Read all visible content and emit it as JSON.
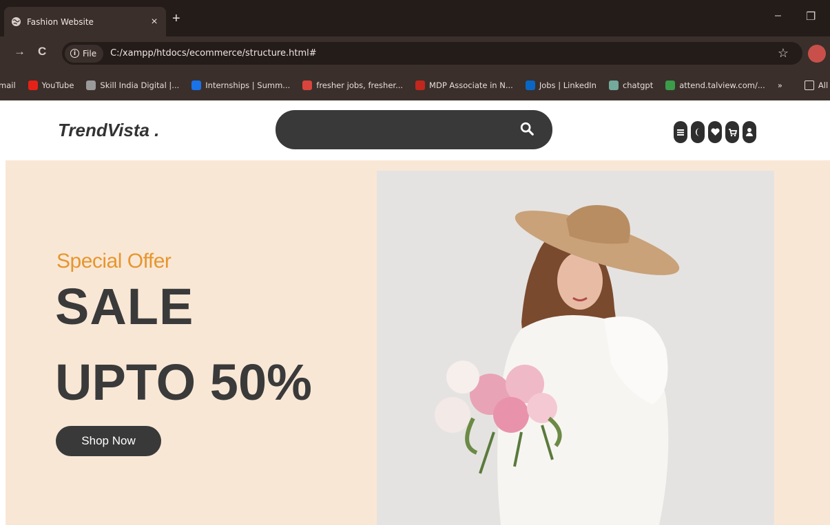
{
  "browser": {
    "tab_title": "Fashion Website",
    "tab_close": "×",
    "new_tab": "+",
    "minimize": "–",
    "restore": "❐",
    "nav_forward": "→",
    "nav_reload": "C",
    "file_chip": "File",
    "url": "C:/xampp/htdocs/ecommerce/structure.html#",
    "bookmarks": [
      {
        "label": "mail",
        "color": "#3a2f2b"
      },
      {
        "label": "YouTube",
        "color": "#e62117"
      },
      {
        "label": "Skill India Digital |...",
        "color": "#9a9a9a"
      },
      {
        "label": "Internships | Summ...",
        "color": "#1a73e8"
      },
      {
        "label": "fresher jobs, fresher...",
        "color": "#d9453d"
      },
      {
        "label": "MDP Associate in N...",
        "color": "#c0271e"
      },
      {
        "label": "Jobs | LinkedIn",
        "color": "#0a66c2"
      },
      {
        "label": "chatgpt",
        "color": "#74aa9c"
      },
      {
        "label": "attend.talview.com/...",
        "color": "#3b9c4a"
      }
    ],
    "more_bookmarks": "»",
    "all_bookmarks": "All Bookr"
  },
  "site": {
    "logo": "TrendVista .",
    "search": {
      "placeholder": ""
    },
    "nav_icons": [
      "menu-icon",
      "moon-icon",
      "heart-icon",
      "cart-icon",
      "user-icon"
    ]
  },
  "hero": {
    "offer": "Special Offer",
    "line1": "SALE",
    "line2": "UPTO 50%",
    "cta": "Shop Now"
  },
  "colors": {
    "hero_bg": "#f9e7d6",
    "accent": "#e6962e",
    "dark": "#393939"
  }
}
